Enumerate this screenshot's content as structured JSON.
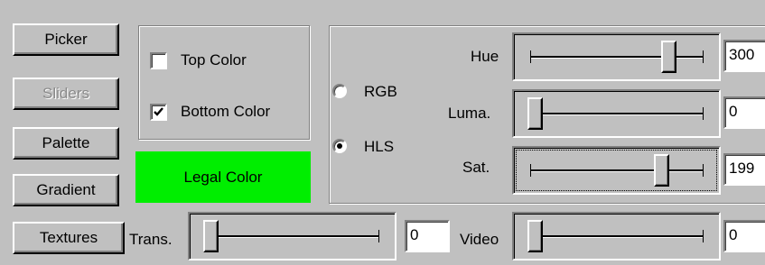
{
  "tabs": {
    "picker": "Picker",
    "sliders": "Sliders",
    "palette": "Palette",
    "gradient": "Gradient",
    "textures": "Textures"
  },
  "target": {
    "top_color": {
      "label": "Top Color",
      "checked": false
    },
    "bottom_color": {
      "label": "Bottom Color",
      "checked": true
    }
  },
  "legal": {
    "label": "Legal Color",
    "color": "#00ee00"
  },
  "mode": {
    "rgb": {
      "label": "RGB",
      "selected": false
    },
    "hls": {
      "label": "HLS",
      "selected": true
    }
  },
  "sliders": {
    "hue": {
      "label": "Hue",
      "value": "300",
      "level": 0.82
    },
    "luma": {
      "label": "Luma.",
      "value": "0",
      "level": 0.0
    },
    "sat": {
      "label": "Sat.",
      "value": "199",
      "level": 0.78
    },
    "trans": {
      "label": "Trans.",
      "value": "0",
      "level": 0.0
    },
    "video": {
      "label": "Video",
      "value": "0",
      "level": 0.0
    }
  },
  "colors": {
    "background": "#c0c0c0",
    "legal_green": "#00ee00"
  }
}
